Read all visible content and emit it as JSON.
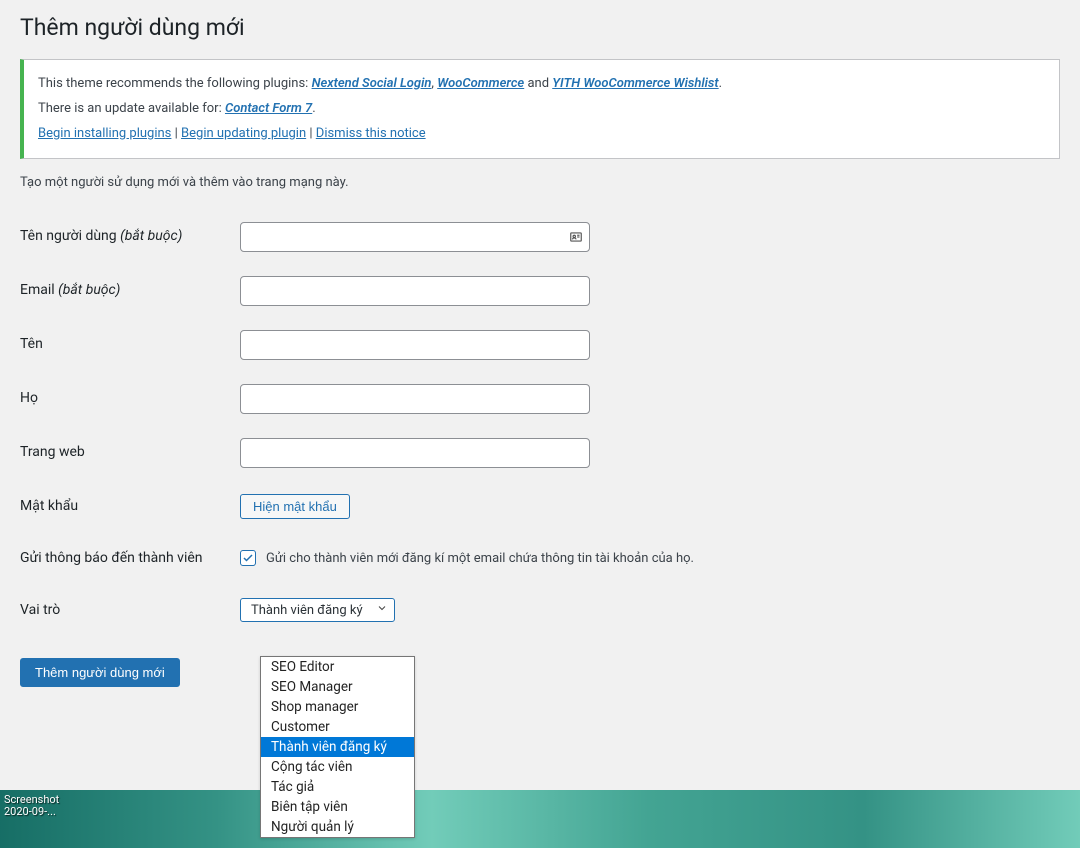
{
  "page": {
    "title": "Thêm người dùng mới",
    "desc": "Tạo một người sử dụng mới và thêm vào trang mạng này."
  },
  "notice": {
    "line1_pre": "This theme recommends the following plugins: ",
    "plugin1": "Nextend Social Login",
    "sep1": ", ",
    "plugin2": "WooCommerce",
    "mid": " and ",
    "plugin3": "YITH WooCommerce Wishlist",
    "end1": ".",
    "line2_pre": "There is an update available for: ",
    "plugin4": "Contact Form 7",
    "end2": ".",
    "link_install": "Begin installing plugins",
    "sepA": " | ",
    "link_update": "Begin updating plugin",
    "sepB": " | ",
    "link_dismiss": "Dismiss this notice"
  },
  "fields": {
    "username_label": "Tên người dùng ",
    "username_req": "(bắt buộc)",
    "email_label": "Email ",
    "email_req": "(bắt buộc)",
    "firstname_label": "Tên",
    "lastname_label": "Họ",
    "website_label": "Trang web",
    "password_label": "Mật khẩu",
    "password_button": "Hiện mật khẩu",
    "notify_label": "Gửi thông báo đến thành viên",
    "notify_text": "Gửi cho thành viên mới đăng kí một email chứa thông tin tài khoản của họ.",
    "role_label": "Vai trò",
    "role_selected": "Thành viên đăng ký"
  },
  "role_options": [
    "SEO Editor",
    "SEO Manager",
    "Shop manager",
    "Customer",
    "Thành viên đăng ký",
    "Cộng tác viên",
    "Tác giả",
    "Biên tập viên",
    "Người quản lý"
  ],
  "role_selected_index": 4,
  "submit": {
    "label": "Thêm người dùng mới"
  },
  "footer": {
    "screenshot_line1": "Screenshot",
    "screenshot_line2": "2020-09-..."
  }
}
